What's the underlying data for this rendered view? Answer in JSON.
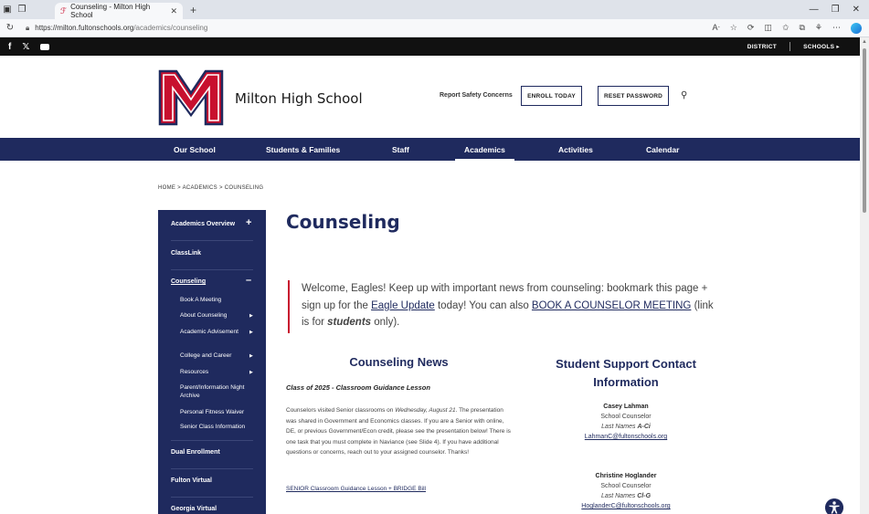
{
  "browser": {
    "tab_title": "Counseling - Milton High School",
    "url_host": "https://milton.fultonschools.org",
    "url_path": "/academics/counseling"
  },
  "utility": {
    "district": "DISTRICT",
    "schools": "SCHOOLS ▸"
  },
  "header": {
    "school_name": "Milton High School",
    "safety_link": "Report Safety Concerns",
    "enroll_label": "ENROLL TODAY",
    "reset_label": "RESET PASSWORD"
  },
  "nav": {
    "items": [
      "Our School",
      "Students & Families",
      "Staff",
      "Academics",
      "Activities",
      "Calendar"
    ],
    "active": "Academics"
  },
  "breadcrumb": "HOME > ACADEMICS > COUNSELING",
  "sidebar": {
    "academics_overview": "Academics Overview",
    "classlink": "ClassLink",
    "counseling": "Counseling",
    "sub": [
      "Book A Meeting",
      "About Counseling",
      "Academic Advisement",
      "College and Career",
      "Resources",
      "Parent/Information Night Archive",
      "Personal Fitness Waiver",
      "Senior Class Information"
    ],
    "dual_enrollment": "Dual Enrollment",
    "fulton_virtual": "Fulton Virtual",
    "georgia_virtual": "Georgia Virtual"
  },
  "main": {
    "title": "Counseling",
    "welcome_1": "Welcome, Eagles! Keep up with important news from counseling: bookmark this page + sign up for the ",
    "eagle_update": "Eagle Update",
    "welcome_2": " today! You can also ",
    "book_link": "BOOK A COUNSELOR MEETING",
    "welcome_3": " (link is for ",
    "students": "students",
    "welcome_4": " only)."
  },
  "news": {
    "heading": "Counseling News",
    "subheading": "Class of 2025 - Classroom Guidance Lesson",
    "body_1": "Counselors visited Senior classrooms on ",
    "body_date": "Wednesday, August 21",
    "body_2": ". The presentation was shared in Government and Economics classes. If you are a Senior with online, DE, or previous Government/Econ credit, please see the presentation below! There is one task that you must complete in Naviance (see Slide 4). If you have additional questions or concerns, reach out to your assigned counselor. Thanks!",
    "link": "SENIOR Classroom Guidance Lesson + BRIDGE Bill"
  },
  "support": {
    "heading": "Student Support Contact Information",
    "contacts": [
      {
        "name": "Casey Lahman",
        "role": "School Counselor",
        "last_names_prefix": "Last Names ",
        "last_names": "A-Ci",
        "email": "LahmanC@fultonschools.org"
      },
      {
        "name": "Christine Hoglander",
        "role": "School Counselor",
        "last_names_prefix": "Last Names ",
        "last_names": "Cl-G",
        "email": "HoglanderC@fultonschools.org"
      }
    ]
  },
  "colors": {
    "navy": "#1f2a5e",
    "red": "#c8102e"
  }
}
